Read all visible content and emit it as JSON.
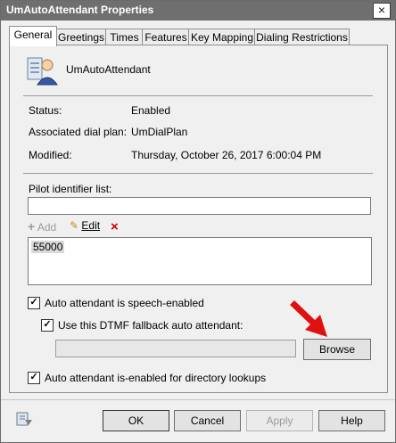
{
  "window": {
    "title": "UmAutoAttendant Properties"
  },
  "tabs": [
    "General",
    "Greetings",
    "Times",
    "Features",
    "Key Mapping",
    "Dialing Restrictions"
  ],
  "general": {
    "name": "UmAutoAttendant",
    "status_label": "Status:",
    "status_value": "Enabled",
    "dialplan_label": "Associated dial plan:",
    "dialplan_value": "UmDialPlan",
    "modified_label": "Modified:",
    "modified_value": "Thursday, October 26, 2017 6:00:04 PM",
    "pilot_label": "Pilot identifier list:",
    "pilot_input_value": "",
    "add_label": "Add",
    "edit_label": "Edit",
    "list_items": [
      "55000"
    ],
    "speech_enabled_label": "Auto attendant is speech-enabled",
    "dtmf_label": "Use this DTMF fallback auto attendant:",
    "dtmf_value": "",
    "browse_label": "Browse",
    "directory_lookup_label": "Auto attendant is-enabled for directory lookups"
  },
  "footer": {
    "ok": "OK",
    "cancel": "Cancel",
    "apply": "Apply",
    "help": "Help"
  },
  "colors": {
    "accent_arrow": "#e01010",
    "titlebar": "#6f6f6f"
  },
  "icons": [
    "close-icon",
    "auto-attendant-icon",
    "add-icon",
    "edit-pencil-icon",
    "delete-x-icon",
    "red-arrow-icon",
    "properties-page-icon"
  ]
}
